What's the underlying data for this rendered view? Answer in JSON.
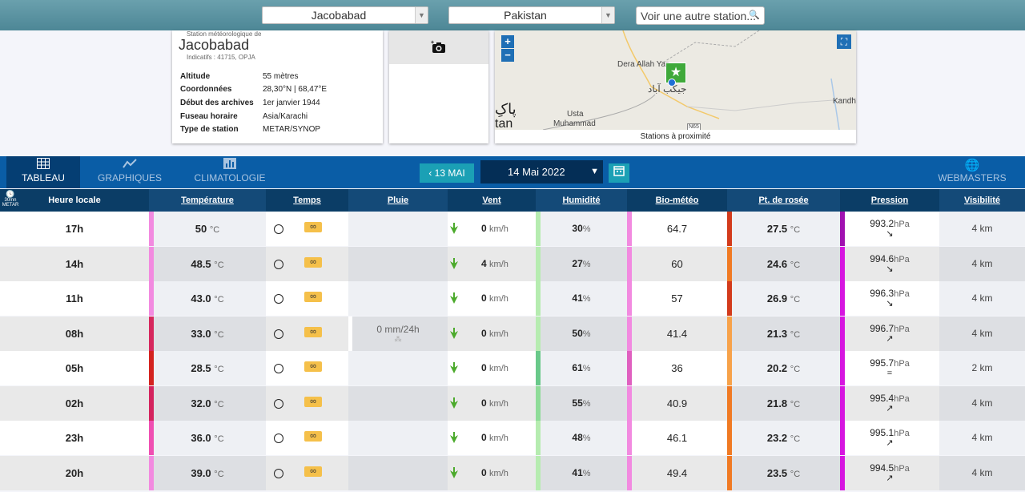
{
  "top": {
    "city_select": "Jacobabad",
    "country_select": "Pakistan",
    "search_placeholder": "Voir une autre station..."
  },
  "station": {
    "subtitle": "Station météorologique de",
    "name": "Jacobabad",
    "indicatifs": "Indicatifs : 41715, OPJA",
    "details": [
      {
        "key": "Altitude",
        "value": "55 mètres"
      },
      {
        "key": "Coordonnées",
        "value": "28,30°N | 68,47°E"
      },
      {
        "key": "Début des archives",
        "value": "1er janvier 1944"
      },
      {
        "key": "Fuseau horaire",
        "value": "Asia/Karachi"
      },
      {
        "key": "Type de station",
        "value": "METAR/SYNOP"
      }
    ]
  },
  "map": {
    "zoom_in": "+",
    "zoom_out": "−",
    "labels": [
      "Dera Allah Yar",
      "جیکب آباد",
      "پاکِ",
      "tan",
      "Usta",
      "Muhammad",
      "Kandh",
      "N65"
    ],
    "footer": "Stations à proximité"
  },
  "nav": {
    "tabs": [
      {
        "label": "TABLEAU",
        "icon": "table-icon"
      },
      {
        "label": "GRAPHIQUES",
        "icon": "chart-line-icon"
      },
      {
        "label": "CLIMATOLOGIE",
        "icon": "bar-chart-icon"
      }
    ],
    "webmasters": "WEBMASTERS",
    "prev_label": "‹ 13 MAI",
    "date": "14 Mai 2022"
  },
  "table": {
    "badge": [
      "30mn",
      "METAR"
    ],
    "headers": [
      "Heure locale",
      "Température",
      "Temps",
      "Pluie",
      "Vent",
      "Humidité",
      "Bio-météo",
      "Pt. de rosée",
      "Pression",
      "Visibilité"
    ],
    "rows": [
      {
        "heure": "17h",
        "temp": "50",
        "pluie": "",
        "vent": "0",
        "hum": "30",
        "bio": "64.7",
        "rosee": "27.5",
        "pression": "993.2",
        "tendance": "↘",
        "vis": "4 km"
      },
      {
        "heure": "14h",
        "temp": "48.5",
        "pluie": "",
        "vent": "4",
        "hum": "27",
        "bio": "60",
        "rosee": "24.6",
        "pression": "994.6",
        "tendance": "↘",
        "vis": "4 km"
      },
      {
        "heure": "11h",
        "temp": "43.0",
        "pluie": "",
        "vent": "0",
        "hum": "41",
        "bio": "57",
        "rosee": "26.9",
        "pression": "996.3",
        "tendance": "↘",
        "vis": "4 km"
      },
      {
        "heure": "08h",
        "temp": "33.0",
        "pluie": "0 mm/24h",
        "vent": "0",
        "hum": "50",
        "bio": "41.4",
        "rosee": "21.3",
        "pression": "996.7",
        "tendance": "↗",
        "vis": "4 km"
      },
      {
        "heure": "05h",
        "temp": "28.5",
        "pluie": "",
        "vent": "0",
        "hum": "61",
        "bio": "36",
        "rosee": "20.2",
        "pression": "995.7",
        "tendance": "=",
        "vis": "2 km"
      },
      {
        "heure": "02h",
        "temp": "32.0",
        "pluie": "",
        "vent": "0",
        "hum": "55",
        "bio": "40.9",
        "rosee": "21.8",
        "pression": "995.4",
        "tendance": "↗",
        "vis": "4 km"
      },
      {
        "heure": "23h",
        "temp": "36.0",
        "pluie": "",
        "vent": "0",
        "hum": "48",
        "bio": "46.1",
        "rosee": "23.2",
        "pression": "995.1",
        "tendance": "↗",
        "vis": "4 km"
      },
      {
        "heure": "20h",
        "temp": "39.0",
        "pluie": "",
        "vent": "0",
        "hum": "41",
        "bio": "49.4",
        "rosee": "23.5",
        "pression": "994.5",
        "tendance": "↗",
        "vis": "4 km"
      }
    ],
    "units": {
      "temp": "°C",
      "vent": "km/h",
      "hum": "%",
      "pression": "hPa"
    },
    "temp_bar_colors": [
      "#f28ae0",
      "#f28ae0",
      "#f28ae0",
      "#d6275d",
      "#d4231f",
      "#d4235e",
      "#ef4fb2",
      "#f28ae0"
    ],
    "hum_bar_colors": [
      "#b6ecb0",
      "#b6ecb0",
      "#b6ecb0",
      "#b6ecb0",
      "#69c98a",
      "#8edc98",
      "#b6ecb0",
      "#b6ecb0"
    ],
    "bio_bar_colors": [
      "#f28ae0",
      "#f28ae0",
      "#f28ae0",
      "#f28ae0",
      "#e060c0",
      "#f28ae0",
      "#f28ae0",
      "#f28ae0"
    ],
    "rosee_bar_colors": [
      "#d33b1c",
      "#f07a24",
      "#d33b1c",
      "#f7a24a",
      "#f7a24a",
      "#f07a24",
      "#f07a24",
      "#f07a24"
    ],
    "pres_bar_colors": [
      "#a011b0",
      "#d616e0",
      "#d616e0",
      "#d616e0",
      "#d616e0",
      "#d616e0",
      "#d616e0",
      "#d616e0"
    ]
  }
}
